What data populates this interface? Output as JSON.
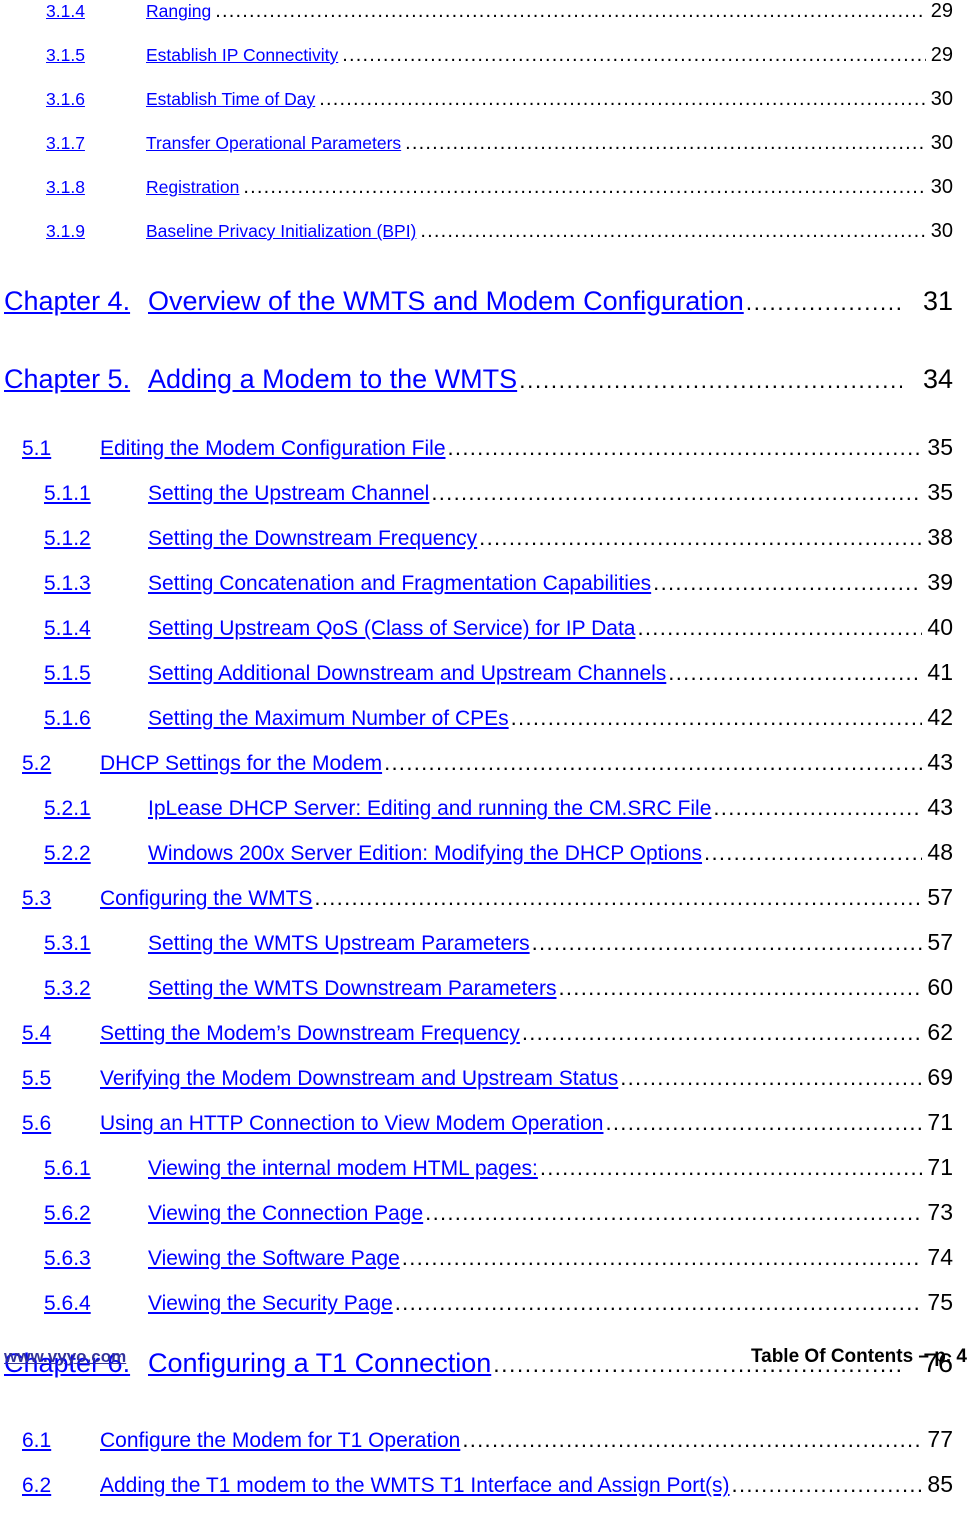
{
  "document": {
    "kind": "table-of-contents",
    "link_color": "#0000ff",
    "page_number_color": "#000000",
    "footer_link_color": "#333399",
    "background": "#ffffff"
  },
  "entries": [
    {
      "level": "sub3-small",
      "number": "3.1.4",
      "title": "Ranging",
      "page": "29"
    },
    {
      "level": "sub3-small",
      "number": "3.1.5",
      "title": "Establish IP Connectivity",
      "page": "29"
    },
    {
      "level": "sub3-small",
      "number": "3.1.6",
      "title": "Establish Time of Day",
      "page": "30"
    },
    {
      "level": "sub3-small",
      "number": "3.1.7",
      "title": "Transfer Operational Parameters",
      "page": "30"
    },
    {
      "level": "sub3-small",
      "number": "3.1.8",
      "title": "Registration",
      "page": "30"
    },
    {
      "level": "sub3-small",
      "number": "3.1.9",
      "title": "Baseline Privacy Initialization (BPI)",
      "page": "30"
    },
    {
      "level": "chapter",
      "number": "Chapter 4.",
      "title": "Overview of the WMTS and Modem Configuration",
      "page": "31"
    },
    {
      "level": "chapter",
      "number": "Chapter 5.",
      "title": "Adding a Modem to the WMTS",
      "page": "34"
    },
    {
      "level": "sub2",
      "number": "5.1",
      "title": "Editing the Modem Configuration File",
      "page": "35"
    },
    {
      "level": "sub3",
      "number": "5.1.1",
      "title": "Setting the Upstream Channel",
      "page": "35"
    },
    {
      "level": "sub3",
      "number": "5.1.2",
      "title": "Setting the Downstream Frequency",
      "page": "38"
    },
    {
      "level": "sub3",
      "number": "5.1.3",
      "title": "Setting Concatenation and Fragmentation Capabilities",
      "page": "39"
    },
    {
      "level": "sub3",
      "number": "5.1.4",
      "title": "Setting Upstream QoS (Class of Service) for IP Data",
      "page": "40"
    },
    {
      "level": "sub3",
      "number": "5.1.5",
      "title": "Setting Additional Downstream and Upstream Channels",
      "page": "41"
    },
    {
      "level": "sub3",
      "number": "5.1.6",
      "title": "Setting the Maximum Number of CPEs",
      "page": "42"
    },
    {
      "level": "sub2",
      "number": "5.2",
      "title": "DHCP Settings for the Modem",
      "page": "43"
    },
    {
      "level": "sub3",
      "number": "5.2.1",
      "title": "IpLease DHCP Server: Editing and running the CM.SRC File",
      "page": "43"
    },
    {
      "level": "sub3",
      "number": "5.2.2",
      "title": "Windows 200x Server Edition: Modifying the  DHCP Options",
      "page": "48"
    },
    {
      "level": "sub2",
      "number": "5.3",
      "title": "Configuring the WMTS",
      "page": "57"
    },
    {
      "level": "sub3",
      "number": "5.3.1",
      "title": "Setting the WMTS Upstream Parameters",
      "page": "57"
    },
    {
      "level": "sub3",
      "number": "5.3.2",
      "title": "Setting the WMTS Downstream Parameters",
      "page": "60"
    },
    {
      "level": "sub2",
      "number": "5.4",
      "title": "Setting the Modem’s Downstream Frequency",
      "page": "62"
    },
    {
      "level": "sub2",
      "number": "5.5",
      "title": "Verifying the Modem Downstream and Upstream Status",
      "page": "69"
    },
    {
      "level": "sub2",
      "number": "5.6",
      "title": "Using an HTTP Connection to View Modem Operation",
      "page": "71"
    },
    {
      "level": "sub3",
      "number": "5.6.1",
      "title": "Viewing the internal modem HTML pages:",
      "page": "71"
    },
    {
      "level": "sub3",
      "number": "5.6.2",
      "title": "Viewing the Connection Page",
      "page": "73"
    },
    {
      "level": "sub3",
      "number": "5.6.3",
      "title": "Viewing the Software Page",
      "page": "74"
    },
    {
      "level": "sub3",
      "number": "5.6.4",
      "title": "Viewing the Security Page",
      "page": "75"
    },
    {
      "level": "chapter",
      "number": "Chapter 6.",
      "title": "Configuring a T1 Connection",
      "page": "76"
    },
    {
      "level": "sub2",
      "number": "6.1",
      "title": "Configure the Modem for T1 Operation",
      "page": "77"
    },
    {
      "level": "sub2",
      "number": "6.2",
      "title": "Adding the T1 modem to the WMTS T1 Interface and Assign Port(s)",
      "page": "85"
    }
  ],
  "footer": {
    "website": "www.vyyo.com",
    "page_label": "Table Of Contents – p. 4"
  }
}
